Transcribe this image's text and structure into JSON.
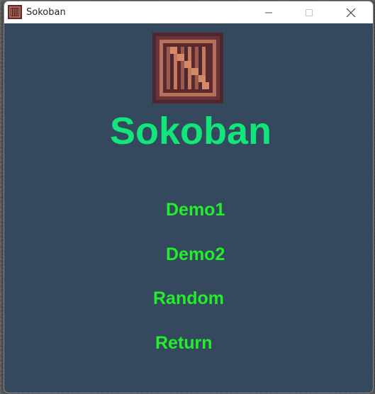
{
  "window": {
    "title": "Sokoban",
    "app_icon": "crate-icon",
    "controls": {
      "minimize_icon": "minimize-icon",
      "maximize_icon": "maximize-icon",
      "close_icon": "close-icon"
    }
  },
  "game": {
    "title": "Sokoban",
    "logo_icon": "crate-icon",
    "title_color": "#12e67a"
  },
  "menu": {
    "items": [
      {
        "label": "Demo1"
      },
      {
        "label": "Demo2"
      },
      {
        "label": "Random"
      },
      {
        "label": "Return"
      }
    ],
    "item_color": "#22ee2a"
  },
  "colors": {
    "background": "#34495e",
    "crate_dark": "#5a2a30",
    "crate_light": "#c47a5a"
  }
}
